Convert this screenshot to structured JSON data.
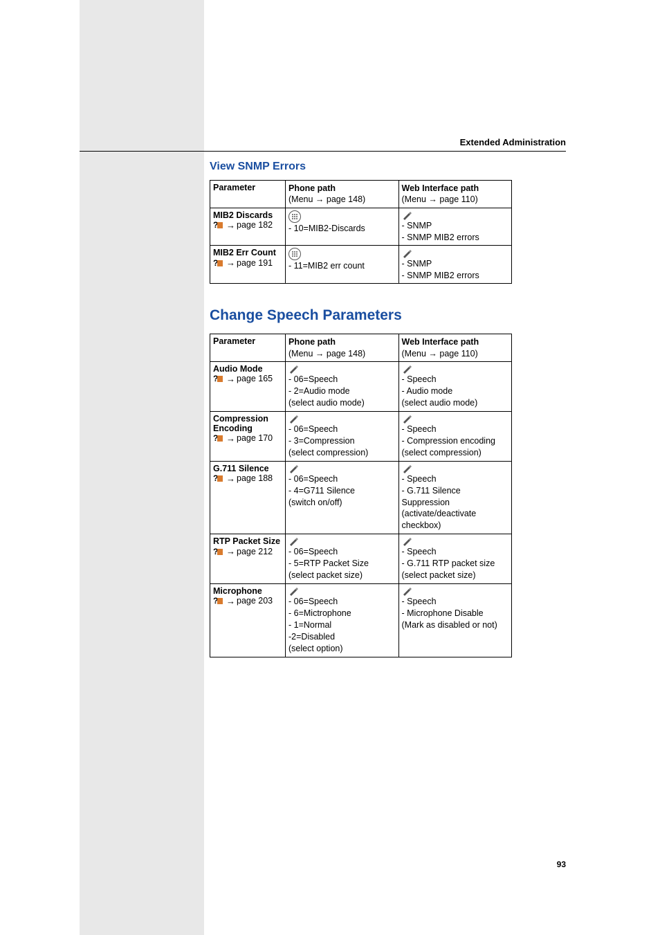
{
  "header": {
    "title": "Extended Administration"
  },
  "section1": {
    "title": "View SNMP Errors",
    "columns": {
      "param": "Parameter",
      "phone": {
        "l1": "Phone path",
        "l2p": "(Menu ",
        "l2a": "→",
        "l2s": " page 148)"
      },
      "web": {
        "l1": "Web Interface path",
        "l2p": "(Menu ",
        "l2a": "→",
        "l2s": " page 110)"
      }
    },
    "rows": [
      {
        "param_name": "MIB2 Discards",
        "param_page": "page 182",
        "phone": [
          "- 10=MIB2-Discards"
        ],
        "web": [
          "- SNMP",
          "- SNMP MIB2 errors"
        ]
      },
      {
        "param_name": "MIB2 Err Count",
        "param_page": "page 191",
        "phone": [
          "- 11=MIB2 err count"
        ],
        "web": [
          "- SNMP",
          "- SNMP MIB2 errors"
        ]
      }
    ]
  },
  "section2": {
    "title": "Change Speech Parameters",
    "columns": {
      "param": "Parameter",
      "phone": {
        "l1": "Phone path",
        "l2p": "(Menu ",
        "l2a": "→",
        "l2s": " page 148)"
      },
      "web": {
        "l1": "Web Interface path",
        "l2p": "(Menu ",
        "l2a": "→",
        "l2s": " page 110)"
      }
    },
    "rows": [
      {
        "param_name": "Audio Mode",
        "param_page": "page 165",
        "phone": [
          "- 06=Speech",
          "- 2=Audio mode",
          "(select audio mode)"
        ],
        "web": [
          "- Speech",
          "- Audio mode",
          "(select audio mode)"
        ]
      },
      {
        "param_name_l1": "Compression",
        "param_name_l2": "Encoding",
        "param_page": "page 170",
        "phone": [
          "- 06=Speech",
          "- 3=Compression",
          "(select compression)"
        ],
        "web": [
          "- Speech",
          "- Compression encoding",
          "(select compression)"
        ]
      },
      {
        "param_name": "G.711 Silence",
        "param_page": "page 188",
        "phone": [
          "- 06=Speech",
          "- 4=G711 Silence",
          "(switch on/off)"
        ],
        "web": [
          "- Speech",
          "- G.711 Silence Suppression",
          "(activate/deactivate checkbox)"
        ]
      },
      {
        "param_name": "RTP Packet Size",
        "param_page": "page 212",
        "phone": [
          "- 06=Speech",
          "- 5=RTP Packet Size",
          "(select packet size)"
        ],
        "web": [
          "- Speech",
          "- G.711 RTP packet size",
          "(select packet size)"
        ]
      },
      {
        "param_name": "Microphone",
        "param_page": "page 203",
        "phone": [
          "- 06=Speech",
          "- 6=Mictrophone",
          "- 1=Normal",
          "-2=Disabled",
          "(select option)"
        ],
        "web": [
          "- Speech",
          "- Microphone Disable",
          "(Mark as disabled or not)"
        ]
      }
    ]
  },
  "footer": {
    "page_number": "93"
  },
  "arrow_glyph": "→"
}
